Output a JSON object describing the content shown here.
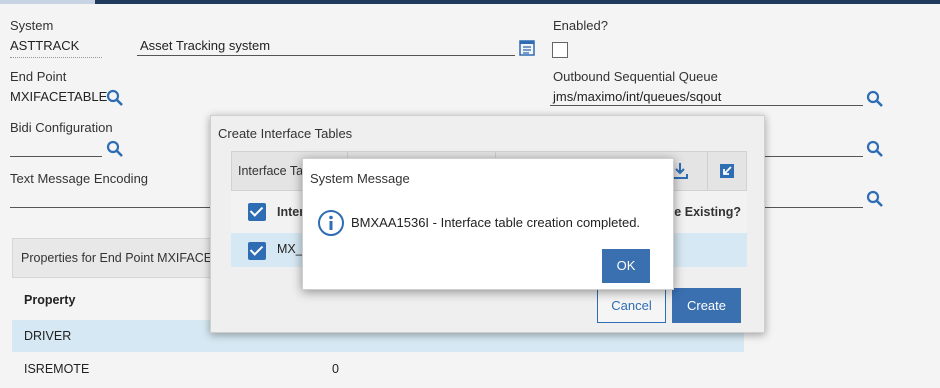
{
  "form": {
    "system_label": "System",
    "system_value": "ASTTRACK",
    "system_desc": "Asset Tracking system",
    "enabled_label": "Enabled?",
    "endpoint_label": "End Point",
    "endpoint_value": "MXIFACETABLE",
    "outbound_label": "Outbound Sequential Queue",
    "outbound_value": "jms/maximo/int/queues/sqout",
    "bidi_label": "Bidi Configuration",
    "bidi_value": "",
    "text_encoding_label": "Text Message Encoding",
    "text_encoding_value": ""
  },
  "properties": {
    "header": "Properties for End Point MXIFACE",
    "column_property": "Property",
    "rows": [
      {
        "property": "DRIVER",
        "value": ""
      },
      {
        "property": "ISREMOTE",
        "value": "0"
      }
    ]
  },
  "create_dialog": {
    "title": "Create Interface Tables",
    "col_interface_table": "Interface Ta",
    "col_interface_short": "Inter",
    "col_existing": "he Existing?",
    "row_value": "MX_",
    "cancel_label": "Cancel",
    "create_label": "Create"
  },
  "system_message": {
    "title": "System Message",
    "message": "BMXAA1536I - Interface table creation completed.",
    "ok_label": "OK"
  },
  "colors": {
    "accent": "#3a6fb0",
    "selected_row": "#d6e8f3",
    "icon_blue": "#2e6db4"
  }
}
